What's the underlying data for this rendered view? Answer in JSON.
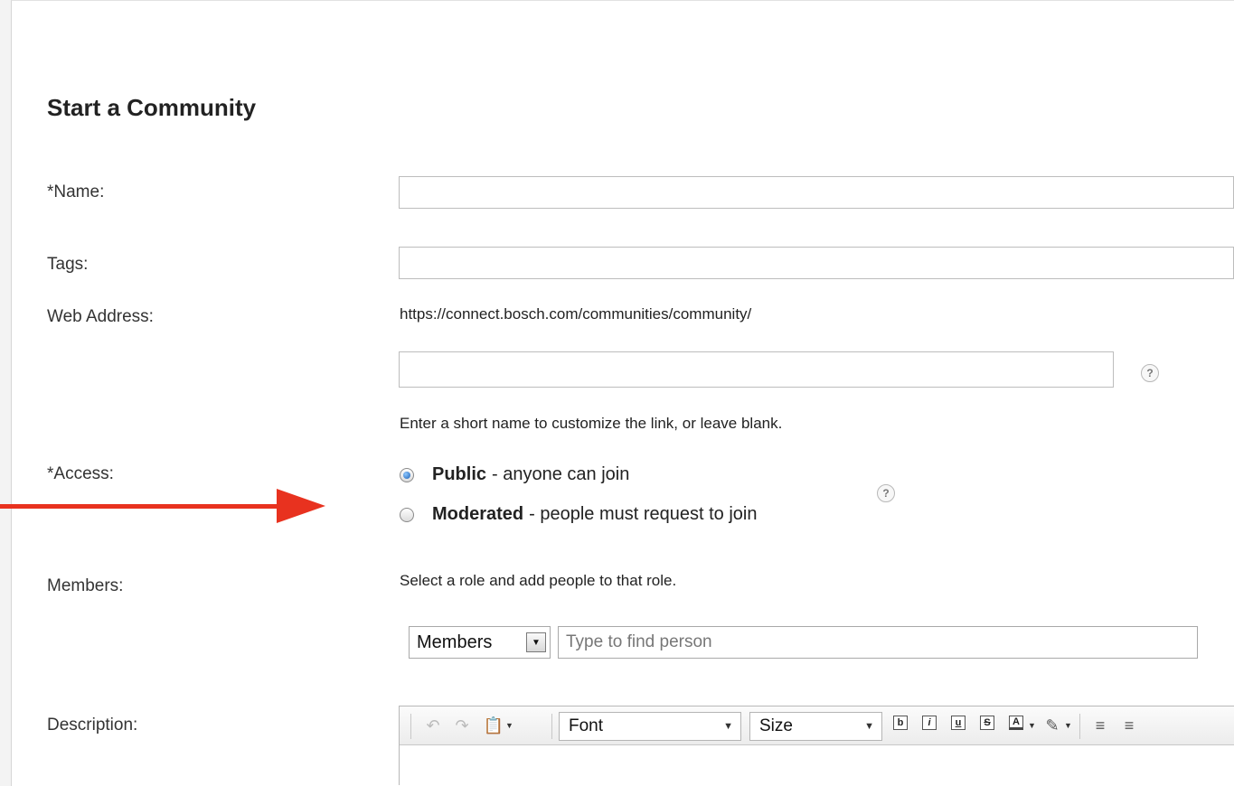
{
  "form": {
    "title": "Start a Community",
    "labels": {
      "name": "*Name:",
      "tags": "Tags:",
      "web_address": "Web Address:",
      "access": "*Access:",
      "members": "Members:",
      "description": "Description:"
    },
    "name_value": "",
    "tags_value": "",
    "web_address_prefix": "https://connect.bosch.com/communities/community/",
    "web_address_value": "",
    "web_address_hint": "Enter a short name to customize the link, or leave blank.",
    "help_glyph": "?",
    "access": {
      "options": [
        {
          "bold": "Public",
          "rest": "- anyone can join",
          "checked": true
        },
        {
          "bold": "Moderated",
          "rest": "- people must request to join",
          "checked": false
        }
      ]
    },
    "members": {
      "hint": "Select a role and add people to that role.",
      "role_selected": "Members",
      "person_placeholder": "Type to find person"
    },
    "editor": {
      "font_label": "Font",
      "size_label": "Size",
      "icons": [
        "undo-icon",
        "redo-icon",
        "paste-icon",
        "bold-icon",
        "italic-icon",
        "underline-icon",
        "strikethrough-icon",
        "font-color-icon",
        "highlight-icon",
        "align-left-icon",
        "align-center-icon"
      ],
      "bold_glyph": "b",
      "italic_glyph": "i",
      "underline_glyph": "u",
      "strike_glyph": "S",
      "font_color_glyph": "A"
    }
  },
  "annotation": {
    "arrow_color": "#e8321f"
  }
}
